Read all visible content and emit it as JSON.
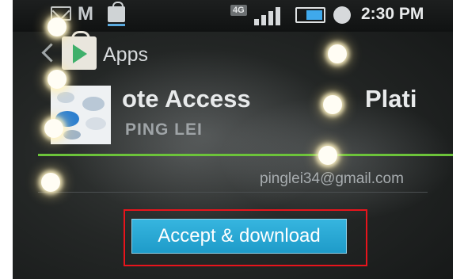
{
  "status_bar": {
    "network_type": "4G",
    "time": "2:30 PM",
    "icons": [
      "mail-icon",
      "gmail-icon",
      "shopping-bag-icon",
      "signal-icon",
      "battery-icon",
      "alarm-icon"
    ]
  },
  "action_bar": {
    "title": "Apps",
    "icons": [
      "back-chevron-icon",
      "play-store-icon"
    ]
  },
  "app": {
    "title_visible": "ote Access",
    "title_right_visible": "Plati",
    "developer": "PING LEI"
  },
  "account": {
    "email": "pinglei34@gmail.com"
  },
  "accept_button": {
    "label": "Accept & download"
  },
  "colors": {
    "accent_green": "#6cc33a",
    "button_blue": "#1e9bc9",
    "highlight_red": "#e8141c"
  }
}
